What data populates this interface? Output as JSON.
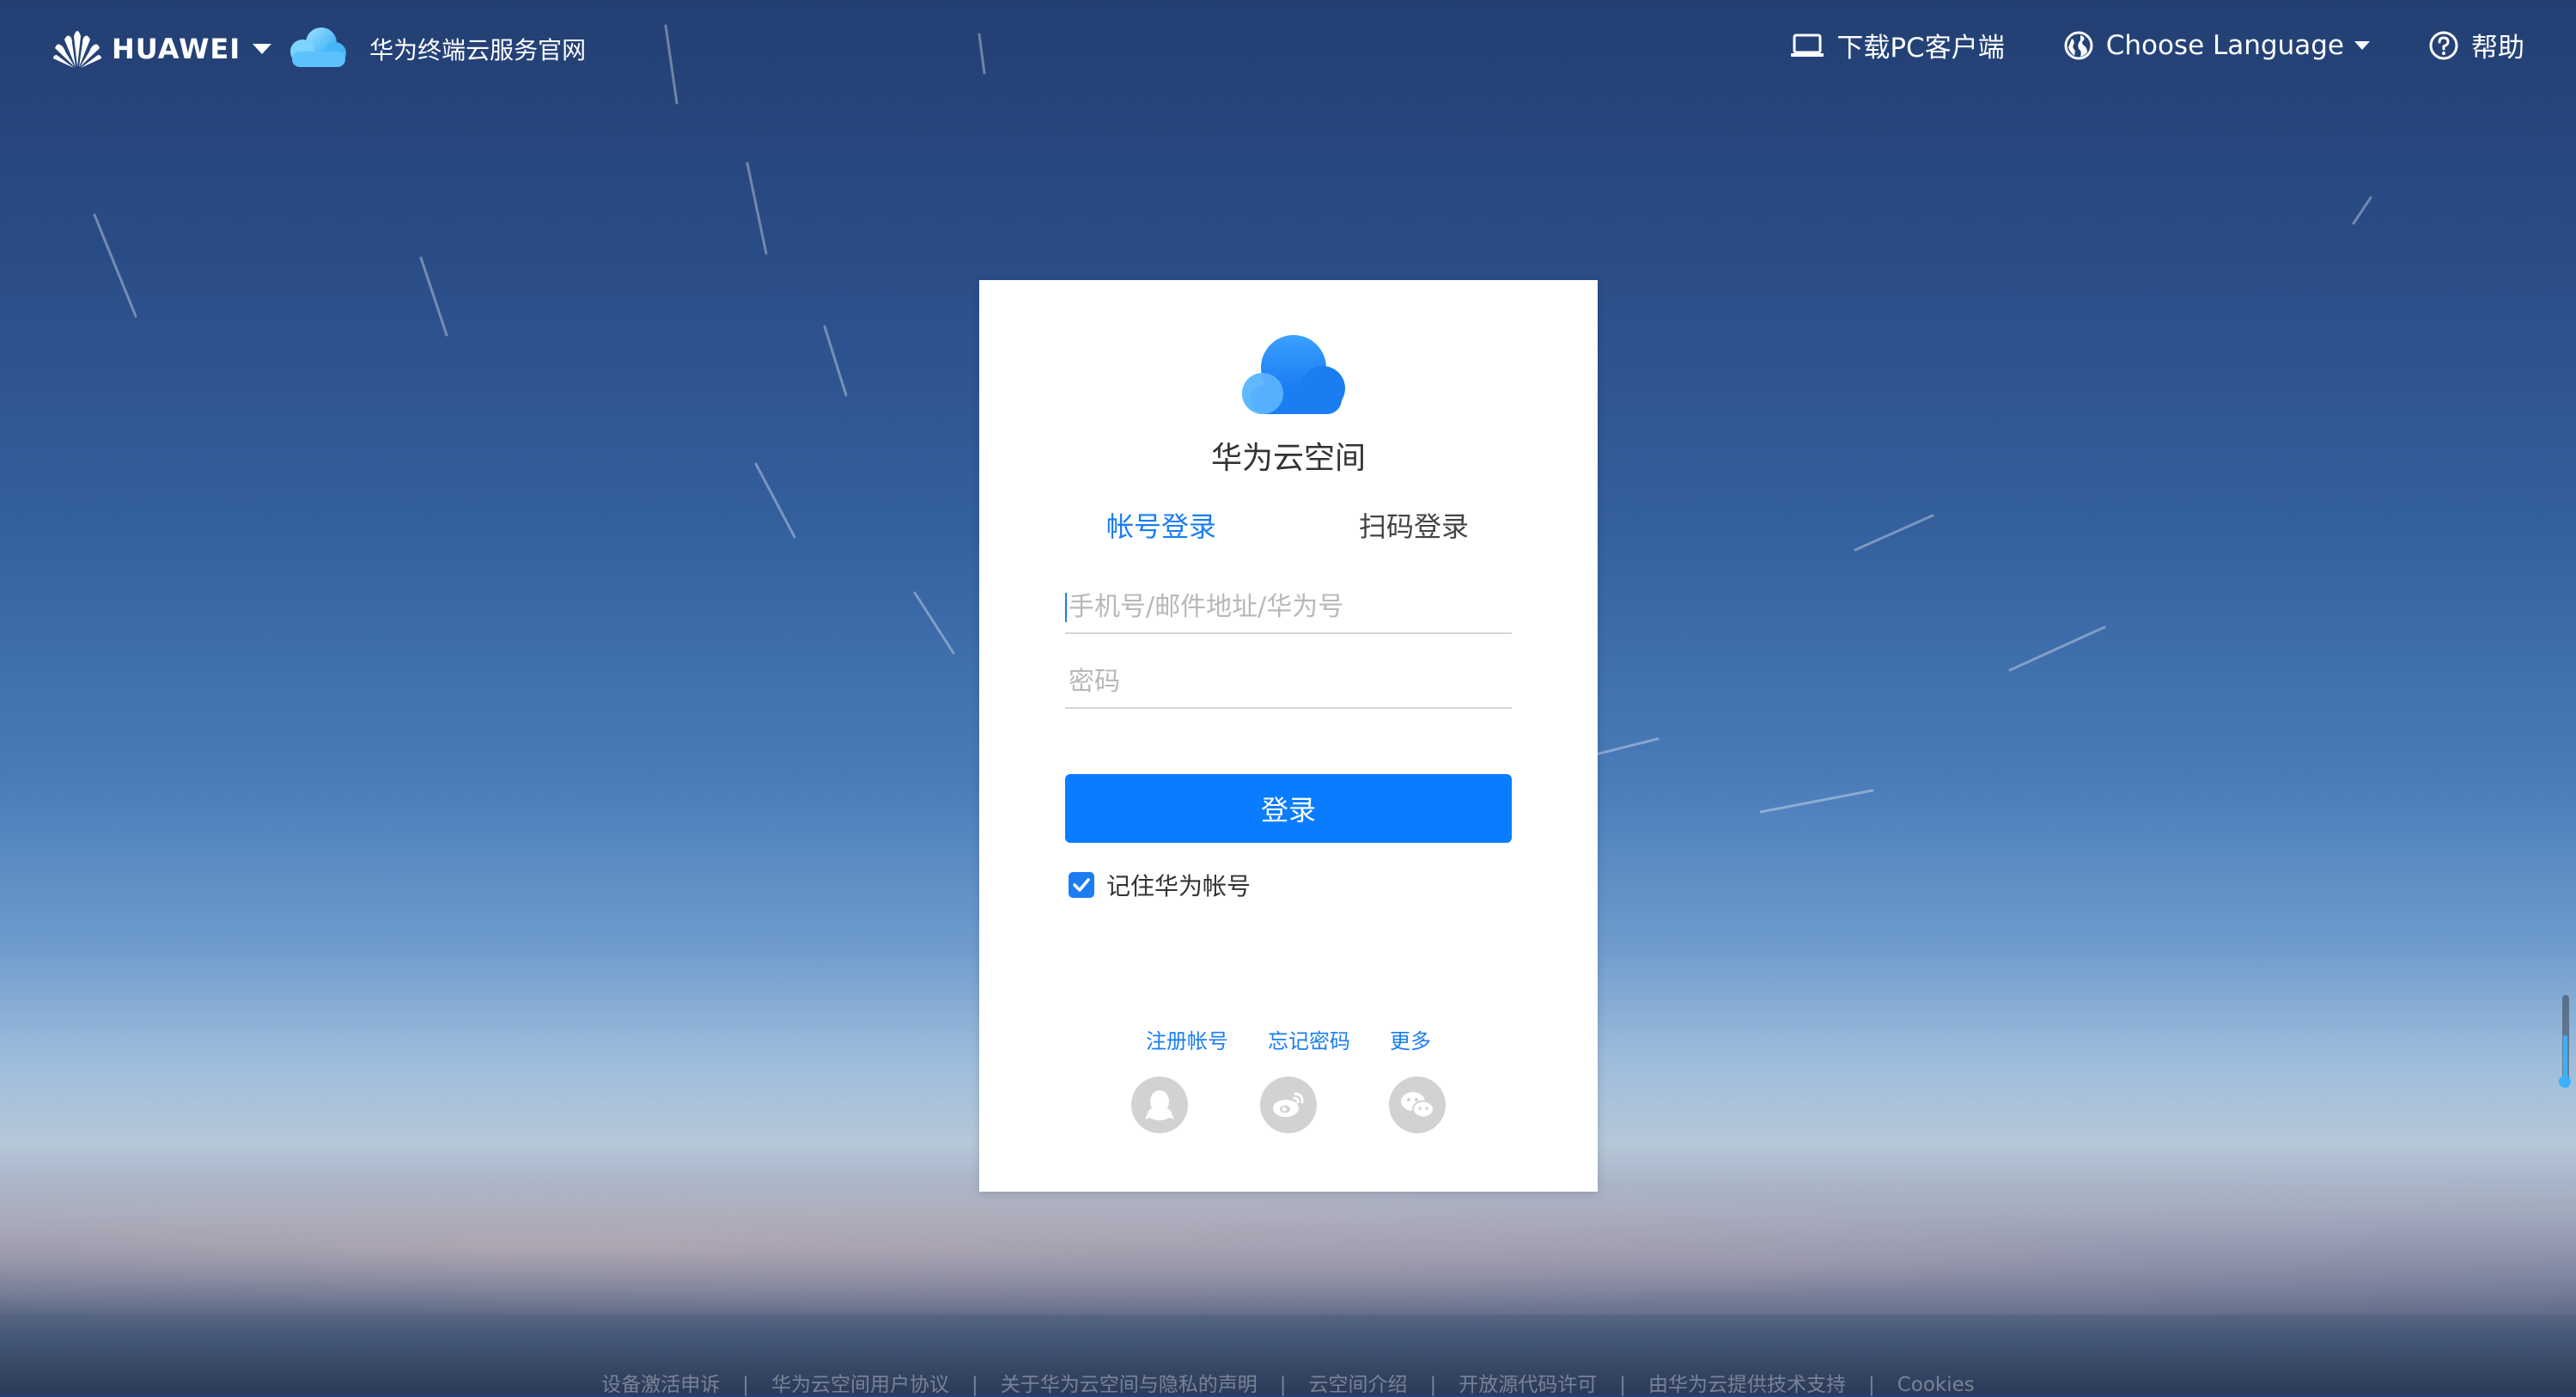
{
  "topbar": {
    "brand": "HUAWEI",
    "site_title": "华为终端云服务官网",
    "download": "下载PC客户端",
    "language": "Choose Language",
    "help": "帮助"
  },
  "login": {
    "title": "华为云空间",
    "tab_account": "帐号登录",
    "tab_qr": "扫码登录",
    "username_placeholder": "手机号/邮件地址/华为号",
    "password_placeholder": "密码",
    "login_button": "登录",
    "remember_label": "记住华为帐号",
    "remember_checked": true,
    "links": {
      "register": "注册帐号",
      "forgot": "忘记密码",
      "more": "更多"
    },
    "socials": [
      "qq-icon",
      "weibo-icon",
      "wechat-icon"
    ]
  },
  "footer": {
    "links": [
      "设备激活申诉",
      "华为云空间用户协议",
      "关于华为云空间与隐私的声明",
      "云空间介绍",
      "开放源代码许可",
      "由华为云提供技术支持",
      "Cookies"
    ]
  },
  "colors": {
    "accent": "#1a7ef2",
    "button": "#0a7cff"
  }
}
